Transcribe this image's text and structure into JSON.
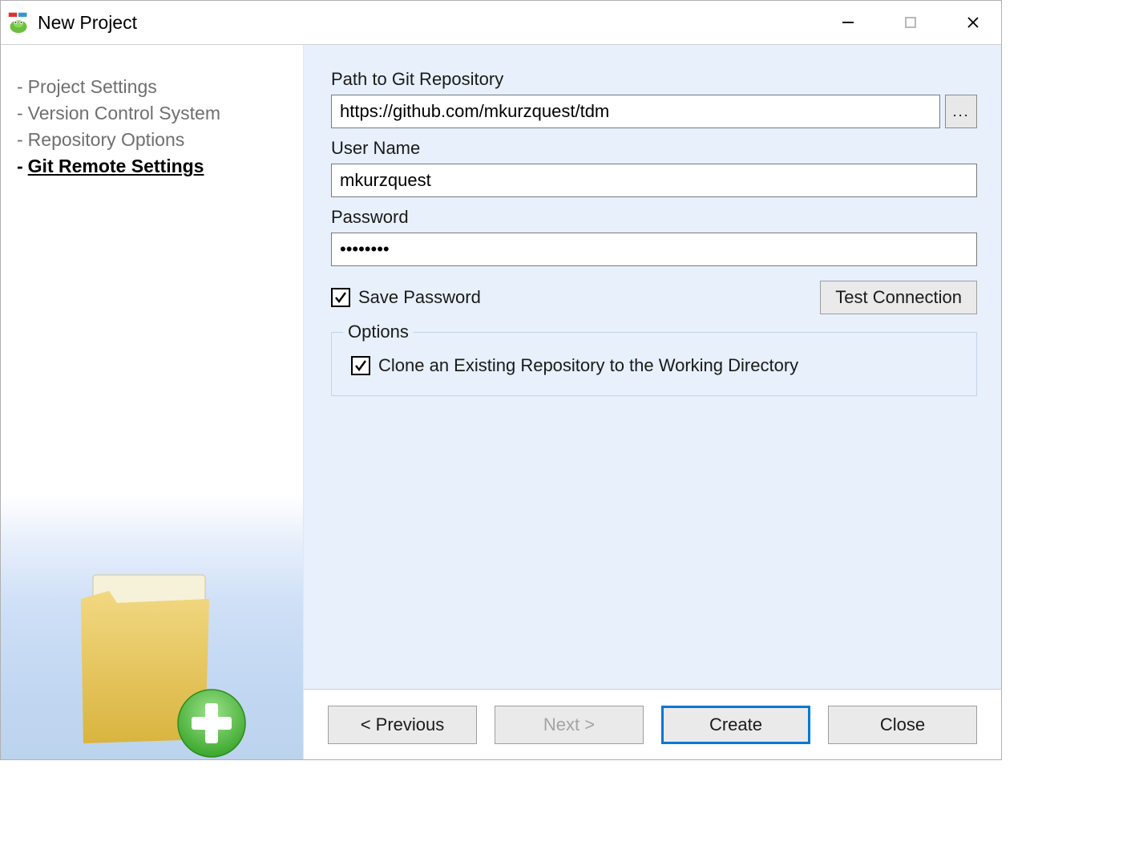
{
  "window": {
    "title": "New Project"
  },
  "sidebar": {
    "items": [
      {
        "label": "Project Settings",
        "current": false
      },
      {
        "label": "Version Control System",
        "current": false
      },
      {
        "label": "Repository Options",
        "current": false
      },
      {
        "label": "Git Remote Settings",
        "current": true
      }
    ]
  },
  "form": {
    "path_label": "Path to Git Repository",
    "path_value": "https://github.com/mkurzquest/tdm",
    "browse_label": "...",
    "user_label": "User Name",
    "user_value": "mkurzquest",
    "password_label": "Password",
    "password_value": "••••••••",
    "save_pw_label": "Save Password",
    "save_pw_checked": true,
    "test_conn_label": "Test Connection",
    "options_label": "Options",
    "clone_label": "Clone an Existing Repository to the Working Directory",
    "clone_checked": true
  },
  "footer": {
    "prev": "< Previous",
    "next": "Next >",
    "create": "Create",
    "close": "Close"
  }
}
